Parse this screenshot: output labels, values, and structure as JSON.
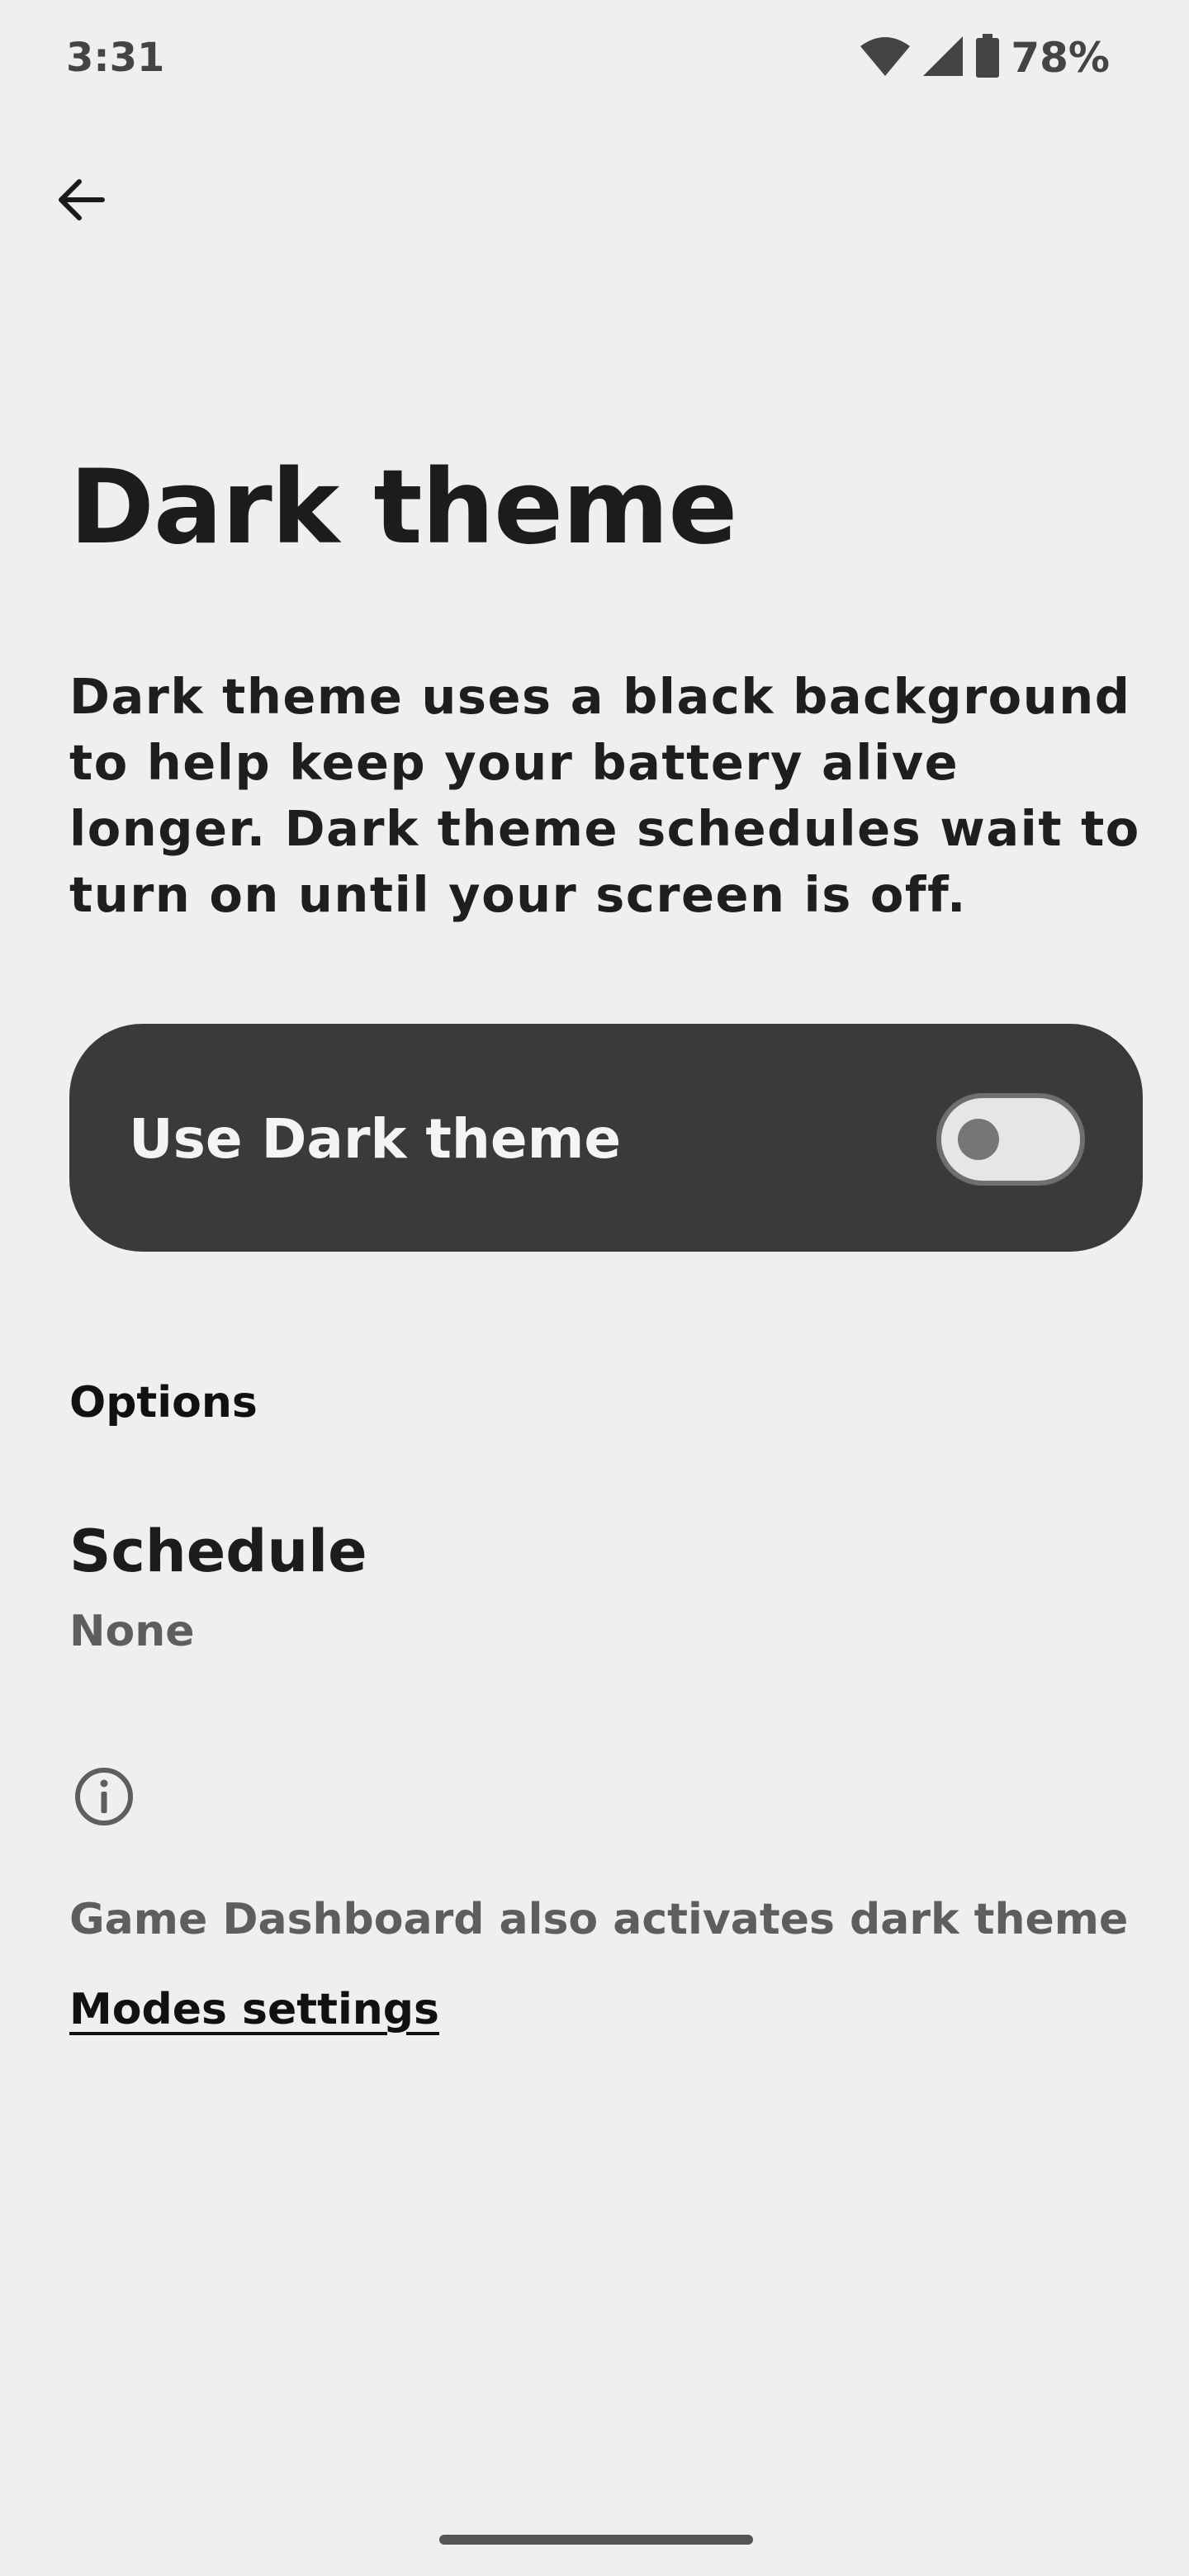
{
  "status_bar": {
    "time": "3:31",
    "battery_percent": "78%",
    "icons": [
      "wifi-icon",
      "cellular-signal-icon",
      "battery-icon"
    ]
  },
  "nav": {
    "back_icon": "arrow-back-icon"
  },
  "page": {
    "title": "Dark theme",
    "description": "Dark theme uses a black background to help keep your battery alive longer. Dark theme schedules wait to turn on until your screen is off."
  },
  "main_switch": {
    "label": "Use Dark theme",
    "checked": false,
    "card_color": "#3a3a3a"
  },
  "options": {
    "header": "Options",
    "schedule_title": "Schedule",
    "schedule_value": "None"
  },
  "footer": {
    "info_icon": "info-icon",
    "text": "Game Dashboard also activates dark theme",
    "link": "Modes settings"
  },
  "colors": {
    "background": "#efefef",
    "text_primary": "#1c1c1c",
    "text_secondary": "#5e5e5e"
  }
}
